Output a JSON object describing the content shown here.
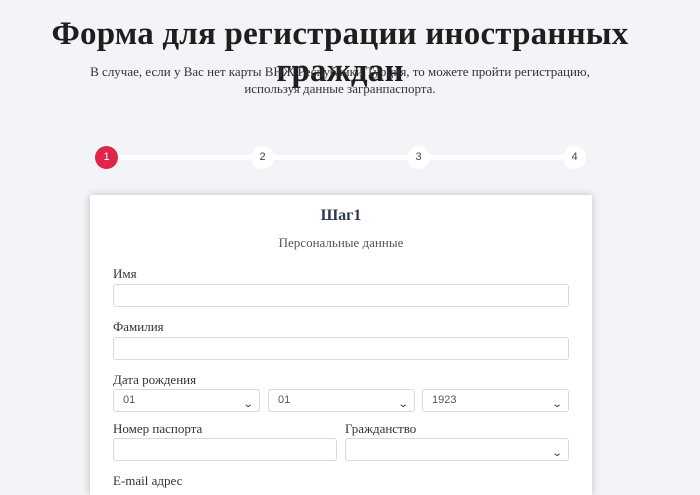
{
  "header": {
    "title": "Форма для регистрации иностранных граждан",
    "subtitle_line1": "В случае, если у Вас нет карты ВНЖ Республики Турция, то можете пройти регистрацию,",
    "subtitle_line2": "используя данные загранпаспорта."
  },
  "stepper": {
    "steps": [
      "1",
      "2",
      "3",
      "4"
    ],
    "active": 1,
    "active_color": "#e0254b"
  },
  "form": {
    "step_title": "Шаг1",
    "step_subtitle": "Персональные данные",
    "first_name": {
      "label": "Имя",
      "value": ""
    },
    "last_name": {
      "label": "Фамилия",
      "value": ""
    },
    "birth_date": {
      "label": "Дата рождения",
      "day": "01",
      "month": "01",
      "year": "1923"
    },
    "passport": {
      "label": "Номер паспорта",
      "value": ""
    },
    "citizenship": {
      "label": "Гражданство",
      "value": ""
    },
    "email": {
      "label": "E-mail адрес"
    }
  }
}
